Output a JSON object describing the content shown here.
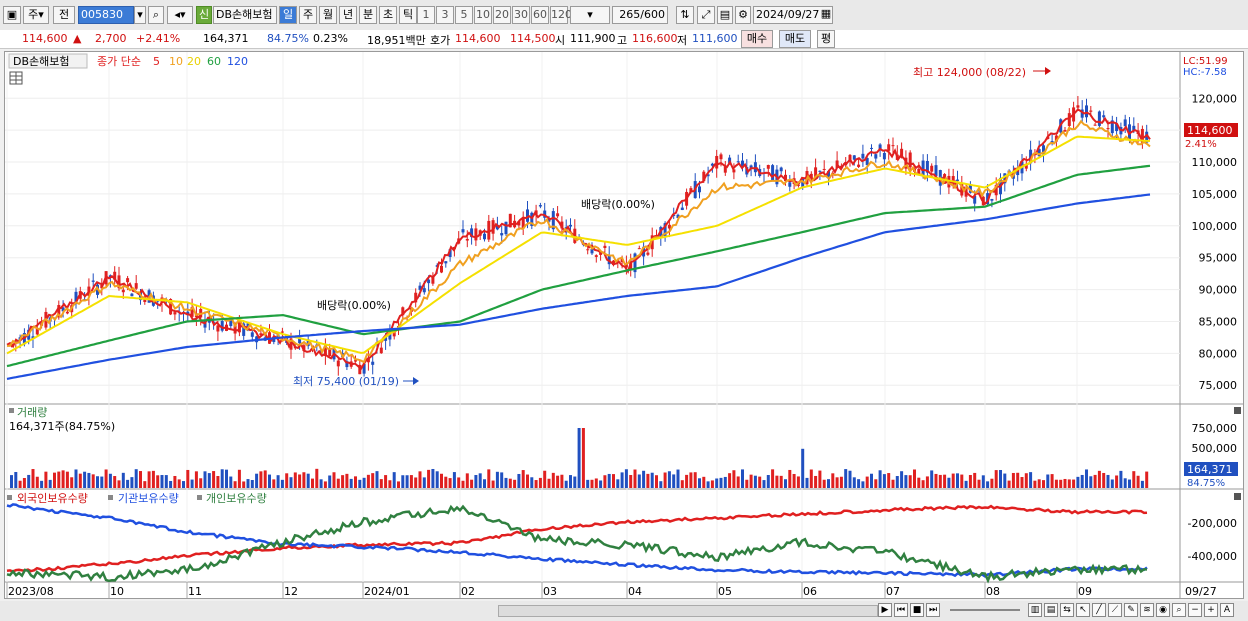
{
  "toolbar": {
    "market_select": "주",
    "code_prev": "전",
    "stock_code": "005830",
    "badge": "신",
    "stock_name": "DB손해보험",
    "periods": [
      "일",
      "주",
      "월",
      "년",
      "분",
      "초",
      "틱"
    ],
    "active_period": "일",
    "intervals": [
      "1",
      "3",
      "5",
      "10",
      "20",
      "30",
      "60",
      "120"
    ],
    "count_display": "265",
    "count_total": "/600",
    "date": "2024/09/27"
  },
  "info": {
    "price": "114,600",
    "change_arrow": "▲",
    "change": "2,700",
    "change_pct": "+2.41%",
    "volume": "164,371",
    "volume_ratio": "84.75%",
    "turnover": "0.23%",
    "amount": "18,951백만",
    "quote_label": "호가",
    "ask": "114,600",
    "bid": "114,500",
    "open_label": "시",
    "open": "111,900",
    "high_label": "고",
    "high": "116,600",
    "low_label": "저",
    "low": "111,600",
    "buy_button": "매수",
    "sell_button": "매도",
    "eval_button": "평"
  },
  "price_panel": {
    "legend_name": "DB손해보험",
    "legend_label": "종가 단순",
    "ma_periods": [
      "5",
      "10",
      "20",
      "60",
      "120"
    ],
    "lc": "LC:51.99",
    "hc": "HC:-7.58",
    "high_annotation": "최고 124,000 (08/22)",
    "low_annotation": "최저 75,400 (01/19)",
    "rights1": "배당락(0.00%)",
    "rights2": "배당락(0.00%)",
    "price_tag": "114,600",
    "price_tag_pct": "2.41%",
    "y_ticks": [
      "120,000",
      "115,000",
      "110,000",
      "105,000",
      "100,000",
      "95,000",
      "90,000",
      "85,000",
      "80,000",
      "75,000"
    ]
  },
  "volume_panel": {
    "title": "거래량",
    "value": "164,371주(84.75%)",
    "y_ticks": [
      "750,000",
      "500,000",
      "250,000"
    ],
    "tag": "164,371",
    "tag_pct": "84.75%"
  },
  "holding_panel": {
    "series": [
      "외국인보유수량",
      "기관보유수량",
      "개인보유수량"
    ],
    "y_ticks": [
      "-200,000",
      "-400,000"
    ]
  },
  "x_axis": {
    "labels": [
      "2023/08",
      "10",
      "11",
      "12",
      "2024/01",
      "02",
      "03",
      "04",
      "05",
      "06",
      "07",
      "08",
      "09"
    ],
    "end_label": "09/27"
  },
  "colors": {
    "ma5": "#e02020",
    "ma10": "#f0a020",
    "ma20": "#f5e000",
    "ma60": "#20a040",
    "ma120": "#2050e0",
    "up": "#e02020",
    "down": "#2050c0",
    "foreign": "#e02020",
    "inst": "#2050e0",
    "retail": "#308040"
  },
  "chart_data": {
    "type": "line",
    "x": [
      "2023/08",
      "2023/10",
      "2023/11",
      "2023/12",
      "2024/01",
      "2024/02",
      "2024/03",
      "2024/04",
      "2024/05",
      "2024/06",
      "2024/07",
      "2024/08",
      "2024/09",
      "09/27"
    ],
    "series": [
      {
        "name": "5",
        "values": [
          81000,
          92000,
          86000,
          82000,
          78000,
          98000,
          102000,
          93000,
          110000,
          107000,
          112000,
          104000,
          118000,
          112000
        ]
      },
      {
        "name": "10",
        "values": [
          81000,
          91000,
          87000,
          82500,
          79000,
          94000,
          101000,
          94000,
          106000,
          107000,
          110000,
          105000,
          116000,
          111000
        ]
      },
      {
        "name": "20",
        "values": [
          80000,
          89000,
          88000,
          83000,
          80000,
          91000,
          99000,
          97000,
          100000,
          106000,
          109000,
          106000,
          114000,
          113000
        ]
      },
      {
        "name": "60",
        "values": [
          78000,
          82000,
          85000,
          86000,
          83000,
          85000,
          90000,
          93000,
          96000,
          99000,
          102000,
          103000,
          108000,
          110000
        ]
      },
      {
        "name": "120",
        "values": [
          76000,
          79000,
          81000,
          82500,
          83500,
          84500,
          87000,
          89000,
          90500,
          95000,
          99000,
          101000,
          103500,
          105500
        ]
      }
    ],
    "ylim": [
      73000,
      126000
    ]
  }
}
